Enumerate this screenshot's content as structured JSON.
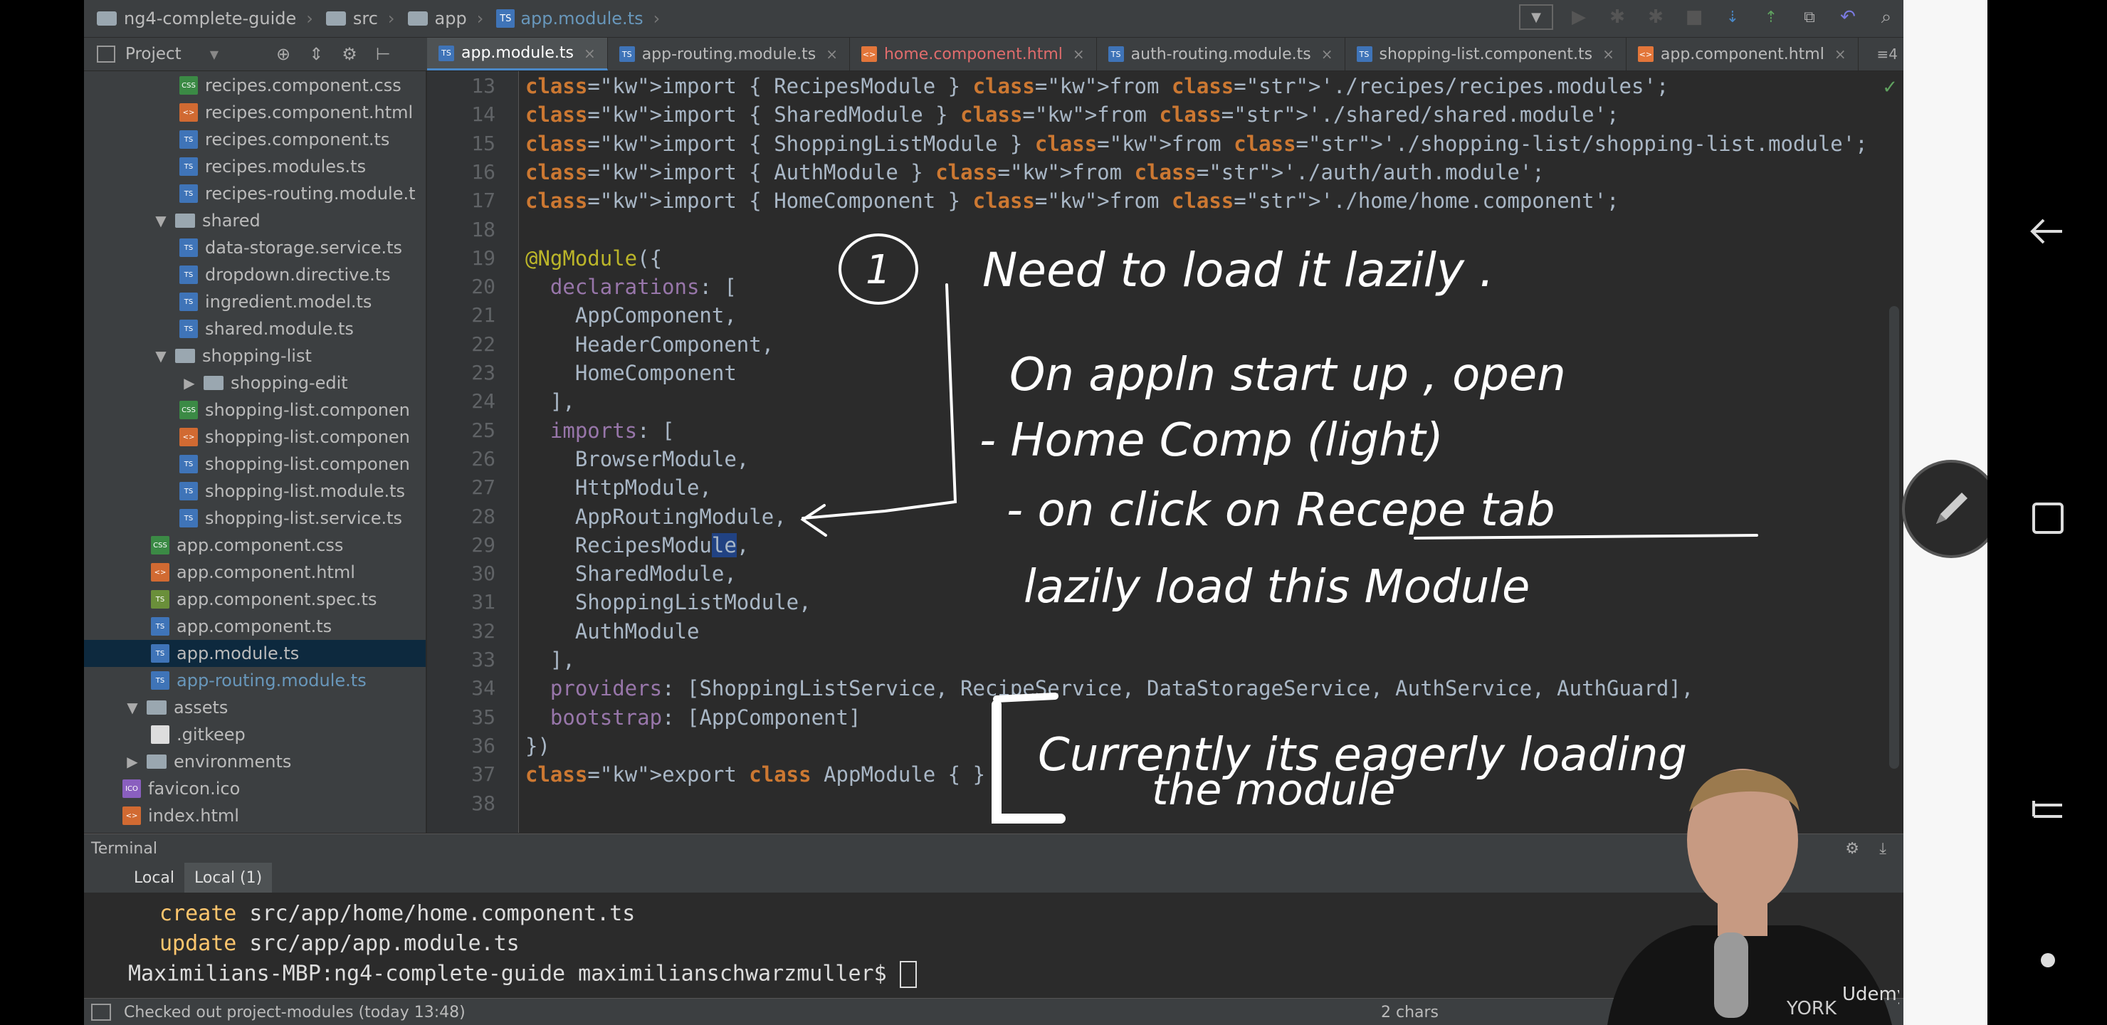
{
  "navbar": {
    "breadcrumbs": [
      "ng4-complete-guide",
      "src",
      "app",
      "app.module.ts"
    ]
  },
  "project_panel": {
    "title": "Project",
    "tree": [
      {
        "label": "recipes.component.css",
        "type": "css",
        "depth": 3
      },
      {
        "label": "recipes.component.html",
        "type": "html",
        "depth": 3
      },
      {
        "label": "recipes.component.ts",
        "type": "ts",
        "depth": 3
      },
      {
        "label": "recipes.modules.ts",
        "type": "ts",
        "depth": 3
      },
      {
        "label": "recipes-routing.module.t",
        "type": "ts",
        "depth": 3
      },
      {
        "label": "shared",
        "type": "folder",
        "depth": 2,
        "expanded": true
      },
      {
        "label": "data-storage.service.ts",
        "type": "ts",
        "depth": 3
      },
      {
        "label": "dropdown.directive.ts",
        "type": "ts",
        "depth": 3
      },
      {
        "label": "ingredient.model.ts",
        "type": "ts",
        "depth": 3
      },
      {
        "label": "shared.module.ts",
        "type": "ts",
        "depth": 3
      },
      {
        "label": "shopping-list",
        "type": "folder",
        "depth": 2,
        "expanded": true
      },
      {
        "label": "shopping-edit",
        "type": "folder",
        "depth": 3,
        "expanded": false
      },
      {
        "label": "shopping-list.componen",
        "type": "css",
        "depth": 3
      },
      {
        "label": "shopping-list.componen",
        "type": "html",
        "depth": 3
      },
      {
        "label": "shopping-list.componen",
        "type": "ts",
        "depth": 3
      },
      {
        "label": "shopping-list.module.ts",
        "type": "ts",
        "depth": 3
      },
      {
        "label": "shopping-list.service.ts",
        "type": "ts",
        "depth": 3
      },
      {
        "label": "app.component.css",
        "type": "css",
        "depth": 2
      },
      {
        "label": "app.component.html",
        "type": "html",
        "depth": 2
      },
      {
        "label": "app.component.spec.ts",
        "type": "spec",
        "depth": 2
      },
      {
        "label": "app.component.ts",
        "type": "ts",
        "depth": 2
      },
      {
        "label": "app.module.ts",
        "type": "ts",
        "depth": 2,
        "selected": true
      },
      {
        "label": "app-routing.module.ts",
        "type": "ts",
        "depth": 2,
        "blue": true
      },
      {
        "label": "assets",
        "type": "folder",
        "depth": 1,
        "expanded": true
      },
      {
        "label": ".gitkeep",
        "type": "plain",
        "depth": 2
      },
      {
        "label": "environments",
        "type": "folder",
        "depth": 1,
        "expanded": false
      },
      {
        "label": "favicon.ico",
        "type": "ico",
        "depth": 1
      },
      {
        "label": "index.html",
        "type": "html",
        "depth": 1
      }
    ]
  },
  "tabs": [
    {
      "label": "app.module.ts",
      "type": "ts",
      "active": true
    },
    {
      "label": "app-routing.module.ts",
      "type": "ts"
    },
    {
      "label": "home.component.html",
      "type": "html",
      "red": true
    },
    {
      "label": "auth-routing.module.ts",
      "type": "ts"
    },
    {
      "label": "shopping-list.component.ts",
      "type": "ts"
    },
    {
      "label": "app.component.html",
      "type": "html"
    }
  ],
  "tabs_more": "≡4",
  "editor": {
    "lines": [
      {
        "n": "13",
        "text": "import { RecipesModule } from './recipes/recipes.modules';"
      },
      {
        "n": "14",
        "text": "import { SharedModule } from './shared/shared.module';"
      },
      {
        "n": "15",
        "text": "import { ShoppingListModule } from './shopping-list/shopping-list.module';"
      },
      {
        "n": "16",
        "text": "import { AuthModule } from './auth/auth.module';"
      },
      {
        "n": "17",
        "text": "import { HomeComponent } from './home/home.component';"
      },
      {
        "n": "18",
        "text": ""
      },
      {
        "n": "19",
        "text": "@NgModule({"
      },
      {
        "n": "20",
        "text": "  declarations: ["
      },
      {
        "n": "21",
        "text": "    AppComponent,"
      },
      {
        "n": "22",
        "text": "    HeaderComponent,"
      },
      {
        "n": "23",
        "text": "    HomeComponent"
      },
      {
        "n": "24",
        "text": "  ],"
      },
      {
        "n": "25",
        "text": "  imports: ["
      },
      {
        "n": "26",
        "text": "    BrowserModule,"
      },
      {
        "n": "27",
        "text": "    HttpModule,"
      },
      {
        "n": "28",
        "text": "    AppRoutingModule,"
      },
      {
        "n": "29",
        "text": "    RecipesModule,"
      },
      {
        "n": "30",
        "text": "    SharedModule,"
      },
      {
        "n": "31",
        "text": "    ShoppingListModule,"
      },
      {
        "n": "32",
        "text": "    AuthModule"
      },
      {
        "n": "33",
        "text": "  ],"
      },
      {
        "n": "34",
        "text": "  providers: [ShoppingListService, RecipeService, DataStorageService, AuthService, AuthGuard],"
      },
      {
        "n": "35",
        "text": "  bootstrap: [AppComponent]"
      },
      {
        "n": "36",
        "text": "})"
      },
      {
        "n": "37",
        "text": "export class AppModule { }"
      },
      {
        "n": "38",
        "text": ""
      }
    ]
  },
  "annotations": {
    "circle_number": "1",
    "line1": "Need to load it lazily .",
    "line2": "On appln start up , open",
    "line3": "- Home Comp (light)",
    "line4": "- on click on Recepe tab",
    "line5": "lazily load this Module",
    "line6": "Currently its eagerly loading",
    "line7": "the module"
  },
  "terminal": {
    "title": "Terminal",
    "tabs": [
      "Local",
      "Local (1)"
    ],
    "lines": [
      {
        "cmd": "create",
        "text": " src/app/home/home.component.ts"
      },
      {
        "cmd": "update",
        "text": " src/app/app.module.ts"
      },
      {
        "cmd": "",
        "text": "Maximilians-MBP:ng4-complete-guide maximilianschwarzmuller$ "
      }
    ]
  },
  "status": {
    "left": "Checked out project-modules (today 13:48)",
    "chars": "2 chars"
  },
  "watermark": "Udemy"
}
